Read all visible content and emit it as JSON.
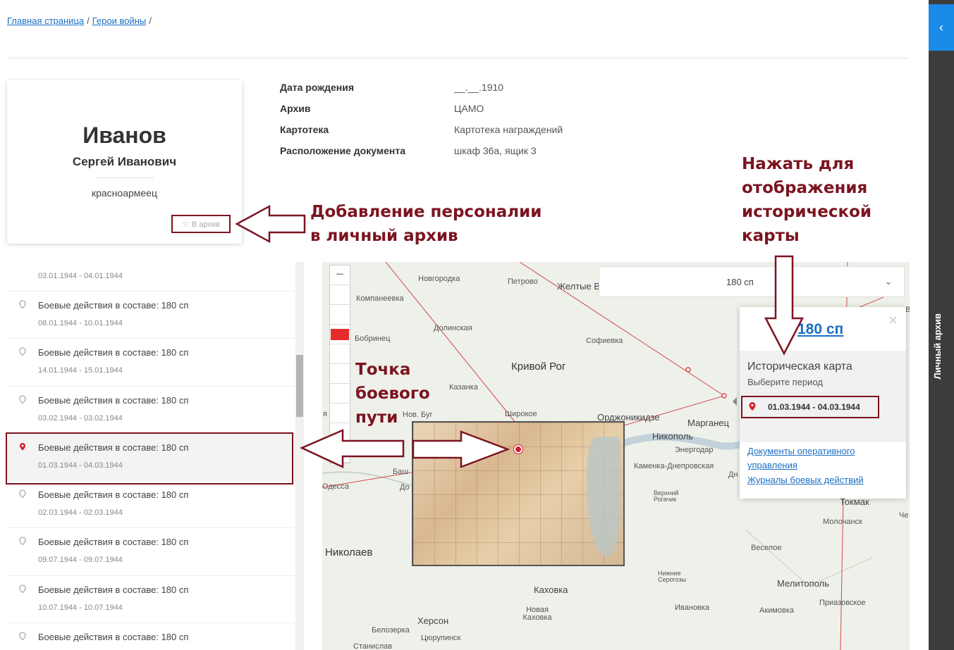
{
  "breadcrumb": {
    "home": "Главная страница",
    "section": "Герои войны",
    "sep": "/"
  },
  "person": {
    "surname": "Иванов",
    "given_names": "Сергей Иванович",
    "rank": "красноармеец",
    "archive_button": "В архив"
  },
  "info": [
    {
      "label": "Дата рождения",
      "value": "__.__.1910"
    },
    {
      "label": "Архив",
      "value": "ЦАМО"
    },
    {
      "label": "Картотека",
      "value": "Картотека награждений"
    },
    {
      "label": "Расположение документа",
      "value": "шкаф 36а, ящик 3"
    }
  ],
  "annotations": {
    "add_archive_1": "Добавление персоналии",
    "add_archive_2": "в личный архив",
    "map_hint_1": "Нажать для",
    "map_hint_2": "отображения",
    "map_hint_3": "исторической",
    "map_hint_4": "карты",
    "point_1": "Точка",
    "point_2": "боевого",
    "point_3": "пути"
  },
  "events": [
    {
      "title": "",
      "date": "03.01.1944 - 04.01.1944"
    },
    {
      "title": "Боевые действия в составе: 180 сп",
      "date": "08.01.1944 - 10.01.1944"
    },
    {
      "title": "Боевые действия в составе: 180 сп",
      "date": "14.01.1944 - 15.01.1944"
    },
    {
      "title": "Боевые действия в составе: 180 сп",
      "date": "03.02.1944 - 03.02.1944"
    },
    {
      "title": "Боевые действия в составе: 180 сп",
      "date": "01.03.1944 - 04.03.1944",
      "active": true
    },
    {
      "title": "Боевые действия в составе: 180 сп",
      "date": "02.03.1944 - 02.03.1944"
    },
    {
      "title": "Боевые действия в составе: 180 сп",
      "date": "09.07.1944 - 09.07.1944"
    },
    {
      "title": "Боевые действия в составе: 180 сп",
      "date": "10.07.1944 - 10.07.1944"
    },
    {
      "title": "Боевые действия в составе: 180 сп",
      "date": ""
    }
  ],
  "map": {
    "zoom_in": "+",
    "zoom_out": "−",
    "unit_select": "180 сп",
    "cities": {
      "novgorodka": "Новгородка",
      "petrovo": "Петрово",
      "zheltye": "Желтые В",
      "kompaneevka": "Компанеевка",
      "dolinskaya": "Долинская",
      "bobrinets": "Бобринец",
      "sofievka": "Софиевка",
      "krivoy_rog": "Кривой Рог",
      "kazanka": "Казанка",
      "nov_bug": "Нов. Буг",
      "shirokoe": "Широкое",
      "ordzhonikidze": "Орджоникидзе",
      "marganets": "Марганец",
      "nikopol": "Никополь",
      "energodar": "Энергодар",
      "kamenka": "Каменка-Днепровская",
      "dn": "Дн",
      "odessa": "Одесса",
      "bash": "Баш",
      "do": "До",
      "verkhniy": "Верхний Рогачик",
      "tokmak": "Токмак",
      "molochansk": "Молочанск",
      "che": "Че",
      "nikolaev": "Николаев",
      "veseloe": "Веселое",
      "nizhnie": "Нижние Серогозы",
      "melitopol": "Мелитополь",
      "kakhovka": "Каховка",
      "novaya_kakhovka": "Новая Каховка",
      "ivanovka": "Ивановка",
      "akimovka": "Акимовка",
      "prizovskoe": "Приазовское",
      "kherson": "Херсон",
      "belozerka": "Белозерка",
      "tsyurupinsk": "Цюрупинск",
      "stanislav": "Станислав",
      "ya": "я",
      "v": "В"
    },
    "popup": {
      "title": "180 сп",
      "heading": "Историческая карта",
      "subheading": "Выберите период",
      "period": "01.03.1944 - 04.03.1944",
      "link_docs": "Документы оперативного управления",
      "link_docs_1": "Документы оперативного",
      "link_docs_2": "управления",
      "link_journals": "Журналы боевых действий"
    }
  },
  "sidepanel": {
    "label": "Личный архив",
    "toggle": "‹"
  },
  "colors": {
    "accent": "#1a6fc4",
    "annotation": "#7b1420",
    "marker": "#d21f2a",
    "sidepanel": "#3c3c3c",
    "toggle": "#1a8be8"
  }
}
